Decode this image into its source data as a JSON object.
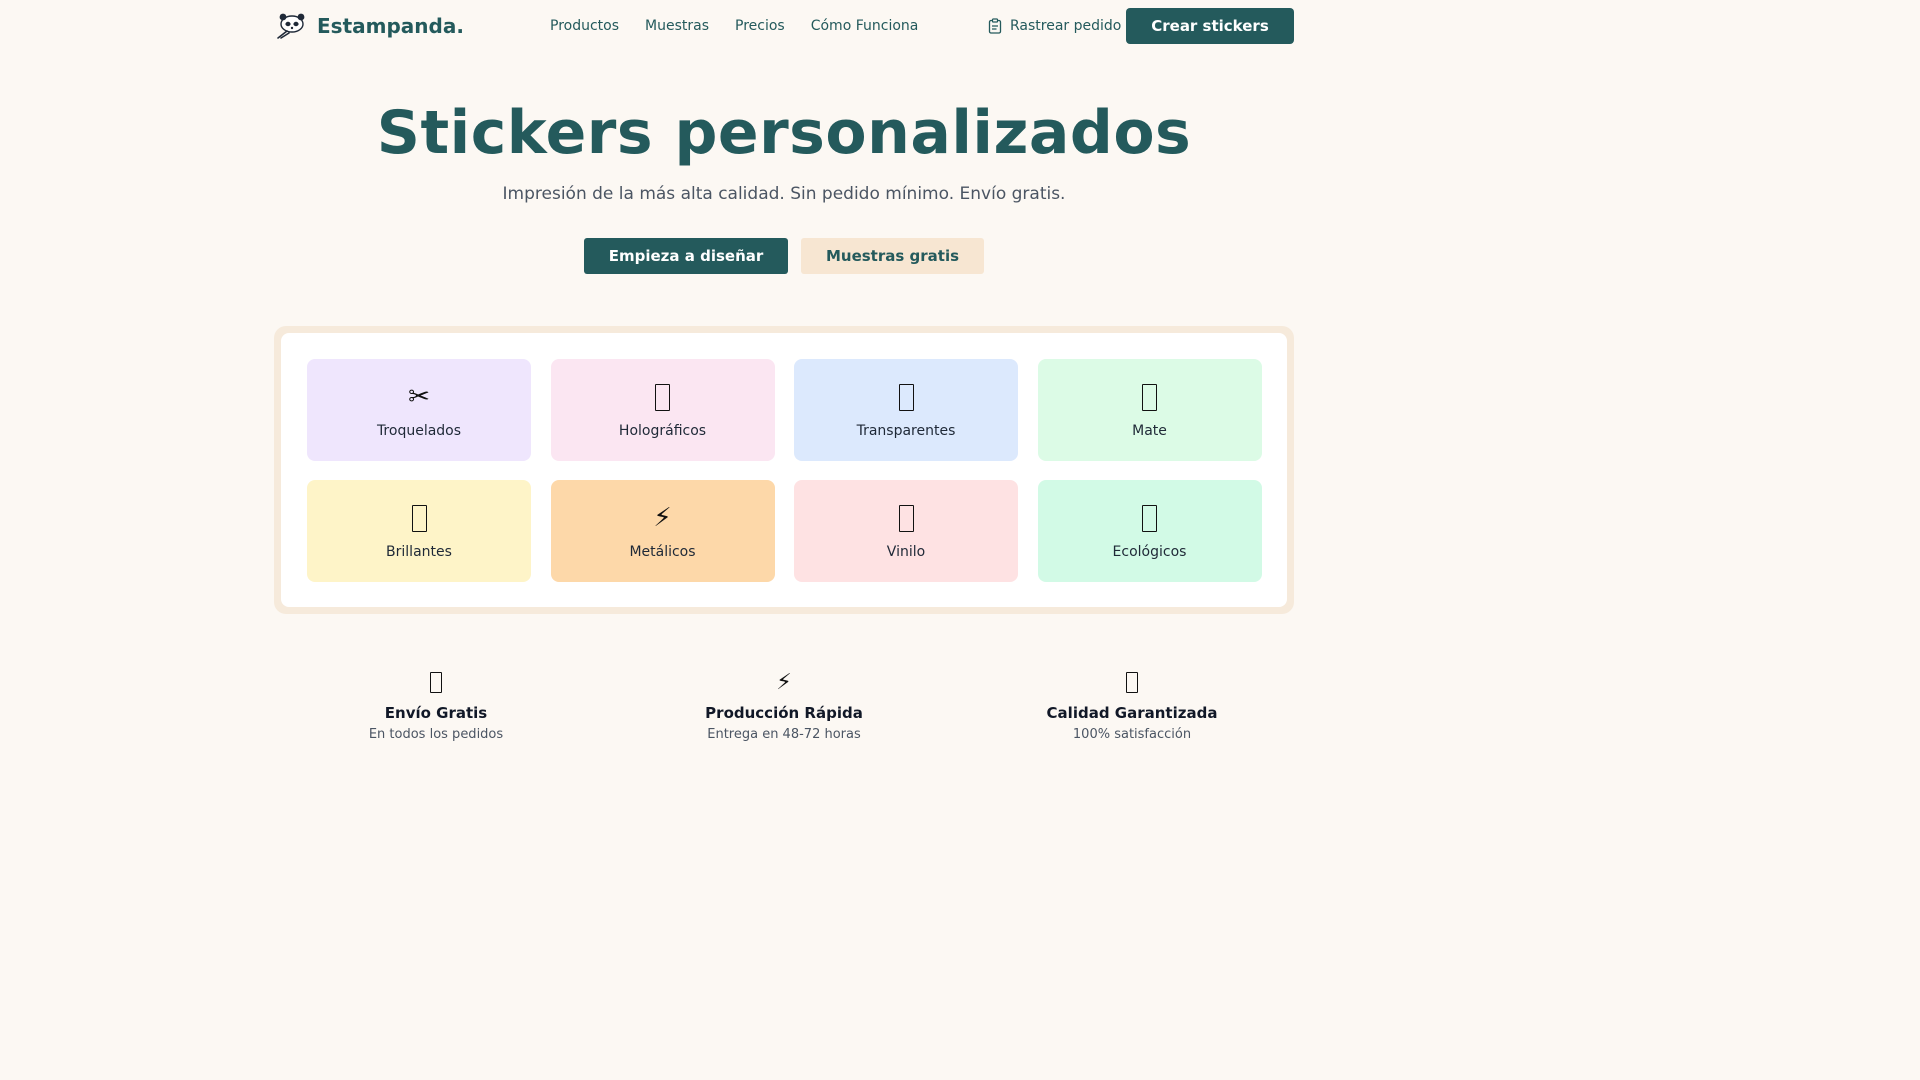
{
  "brand": {
    "name": "Estampanda."
  },
  "nav": {
    "items": [
      "Productos",
      "Muestras",
      "Precios",
      "Cómo Funciona"
    ],
    "track_label": "Rastrear pedido",
    "cta_label": "Crear stickers"
  },
  "hero": {
    "title": "Stickers personalizados",
    "subtitle": "Impresión de la más alta calidad. Sin pedido mínimo. Envío gratis.",
    "primary_label": "Empieza a diseñar",
    "secondary_label": "Muestras gratis"
  },
  "products": [
    {
      "label": "Troquelados",
      "icon": "scissors-icon",
      "color": "#efe6fd"
    },
    {
      "label": "Holográficos",
      "icon": "sparkle-icon",
      "color": "#fbe6f2"
    },
    {
      "label": "Transparentes",
      "icon": "crystal-icon",
      "color": "#dce9fd"
    },
    {
      "label": "Mate",
      "icon": "palette-icon",
      "color": "#dcfbe6"
    },
    {
      "label": "Brillantes",
      "icon": "star-icon",
      "color": "#fef4c8"
    },
    {
      "label": "Metálicos",
      "icon": "lightning-icon",
      "color": "#fdd8a9"
    },
    {
      "label": "Vinilo",
      "icon": "vinyl-icon",
      "color": "#fee2e3"
    },
    {
      "label": "Ecológicos",
      "icon": "leaf-icon",
      "color": "#d2fae6"
    }
  ],
  "features": [
    {
      "title": "Envío Gratis",
      "subtitle": "En todos los pedidos",
      "icon": "truck-icon"
    },
    {
      "title": "Producción Rápida",
      "subtitle": "Entrega en 48-72 horas",
      "icon": "lightning-icon"
    },
    {
      "title": "Calidad Garantizada",
      "subtitle": "100% satisfacción",
      "icon": "badge-icon"
    }
  ],
  "colors": {
    "brand": "#245a5c",
    "background": "#fcf8f3",
    "secondary_button": "#f7e6d2"
  }
}
